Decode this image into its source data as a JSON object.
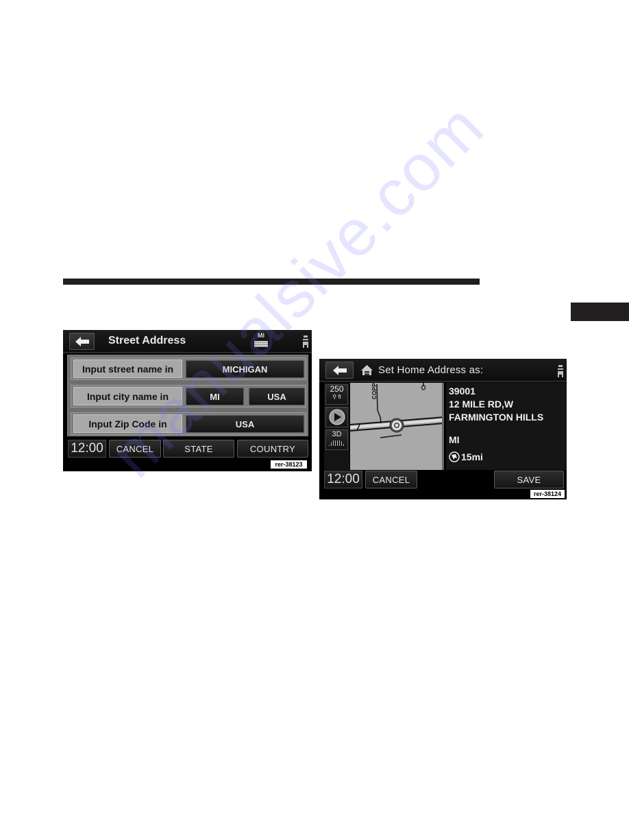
{
  "page": {
    "watermark": "manualsive.com"
  },
  "left_screen": {
    "title": "Street Address",
    "state_indicator": "MI",
    "rows": [
      {
        "label": "Input street name in",
        "options": [
          "MICHIGAN"
        ]
      },
      {
        "label": "Input city name in",
        "options": [
          "MI",
          "USA"
        ]
      },
      {
        "label": "Input Zip Code in",
        "options": [
          "USA"
        ]
      }
    ],
    "footer": {
      "clock": "12:00",
      "buttons": [
        "CANCEL",
        "STATE",
        "COUNTRY"
      ]
    },
    "ref_tag": "rer-38123"
  },
  "right_screen": {
    "title": "Set Home Address as:",
    "map_tools": {
      "zoom_scale": "250",
      "zoom_unit": "ft",
      "view_mode": "3D"
    },
    "map": {
      "road_label": "COPPL"
    },
    "address": {
      "number": "39001",
      "street": "12 MILE RD,W",
      "city": "FARMINGTON HILLS",
      "state": "MI",
      "distance": "15mi"
    },
    "footer": {
      "clock": "12:00",
      "cancel": "CANCEL",
      "save": "SAVE"
    },
    "ref_tag": "rer-38124"
  },
  "colors": {
    "screen_bg": "#000000",
    "panel_gray": "#a8a8a8",
    "map_gray": "#a9a9a9",
    "rule": "#231f20"
  }
}
